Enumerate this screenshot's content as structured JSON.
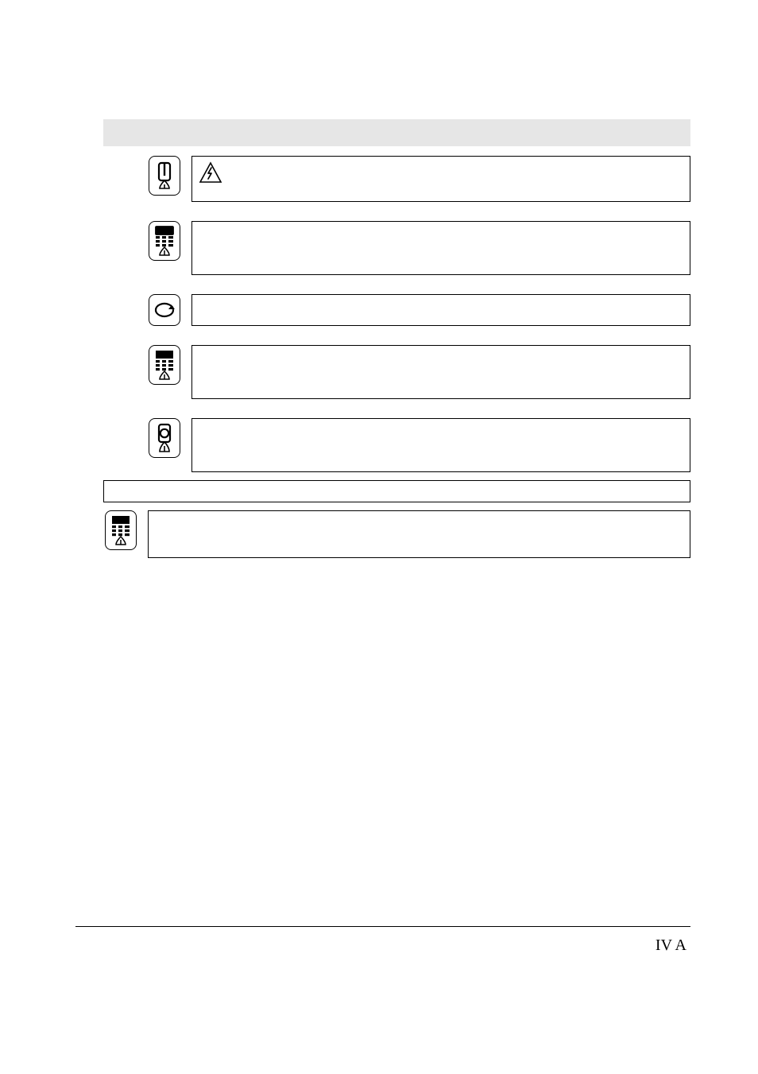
{
  "footer": {
    "label": "IV A"
  },
  "steps": [
    {
      "icon": "switch-on-icon",
      "content_icon": "voltage-warning-icon",
      "height": "normal"
    },
    {
      "icon": "keypad-icon",
      "content_icon": null,
      "height": "tall"
    },
    {
      "icon": "loop-icon",
      "content_icon": null,
      "height": "short"
    },
    {
      "icon": "keypad-icon",
      "content_icon": null,
      "height": "tall"
    },
    {
      "icon": "switch-off-icon",
      "content_icon": null,
      "height": "tall"
    }
  ],
  "lower_step": {
    "icon": "keypad-icon"
  }
}
